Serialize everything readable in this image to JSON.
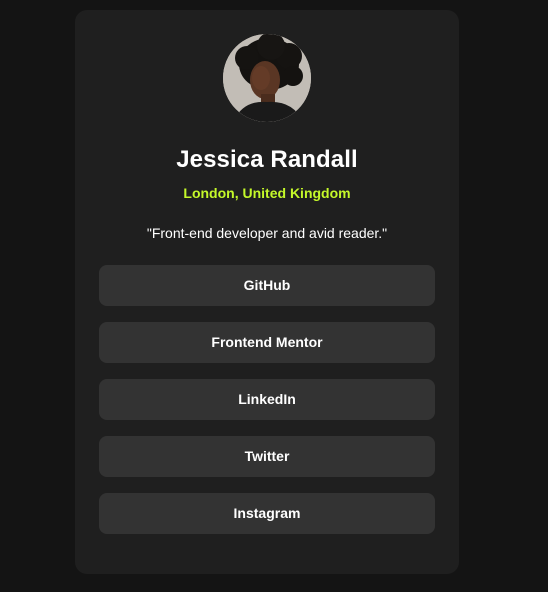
{
  "profile": {
    "name": "Jessica Randall",
    "location": "London, United Kingdom",
    "bio": "\"Front-end developer and avid reader.\"",
    "avatar_icon": "profile-photo"
  },
  "links": [
    {
      "label": "GitHub"
    },
    {
      "label": "Frontend Mentor"
    },
    {
      "label": "LinkedIn"
    },
    {
      "label": "Twitter"
    },
    {
      "label": "Instagram"
    }
  ],
  "colors": {
    "background": "#141414",
    "card": "#1f1f1f",
    "button": "#333333",
    "accent": "#c4f82a",
    "text": "#ffffff"
  }
}
